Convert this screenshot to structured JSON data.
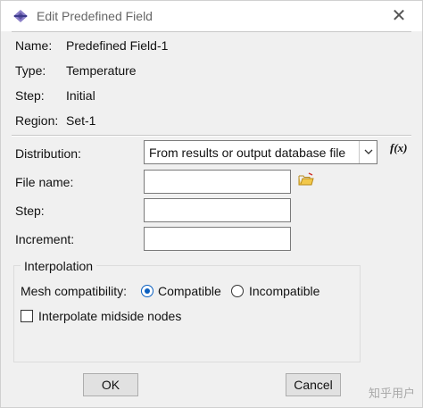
{
  "window": {
    "title": "Edit Predefined Field",
    "icon": "abaqus-app-icon",
    "close_label": "✕"
  },
  "info": {
    "name_label": "Name:",
    "name_value": "Predefined Field-1",
    "type_label": "Type:",
    "type_value": "Temperature",
    "step_label": "Step:",
    "step_value": "Initial",
    "region_label": "Region:",
    "region_value": "Set-1"
  },
  "form": {
    "distribution_label": "Distribution:",
    "distribution_value": "From results or output database file",
    "fx_label": "f(x)",
    "file_name_label": "File name:",
    "file_name_value": "",
    "step_label": "Step:",
    "step_value": "",
    "increment_label": "Increment:",
    "increment_value": ""
  },
  "interpolation": {
    "group_title": "Interpolation",
    "mesh_label": "Mesh compatibility:",
    "option_compatible": "Compatible",
    "option_incompatible": "Incompatible",
    "selected": "Compatible",
    "midside_label": "Interpolate midside nodes",
    "midside_checked": false
  },
  "buttons": {
    "ok": "OK",
    "cancel": "Cancel"
  },
  "watermark": "知乎用户",
  "colors": {
    "accent": "#0a5fc0",
    "window_bg": "#f0f0f0"
  }
}
